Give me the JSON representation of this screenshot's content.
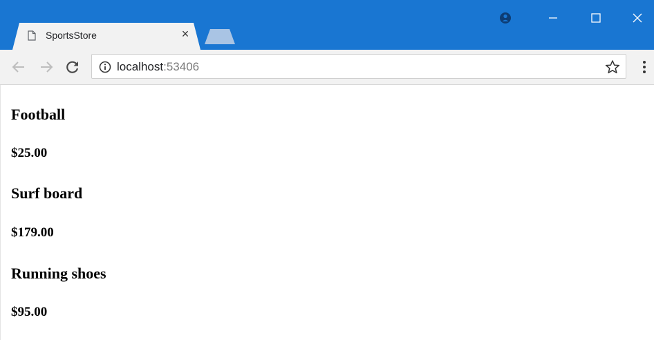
{
  "browser": {
    "tab_title": "SportsStore",
    "address": {
      "host": "localhost",
      "port": ":53406"
    }
  },
  "products": [
    {
      "name": "Football",
      "price": "$25.00"
    },
    {
      "name": "Surf board",
      "price": "$179.00"
    },
    {
      "name": "Running shoes",
      "price": "$95.00"
    }
  ],
  "icons": {
    "page": "page-icon",
    "close": "close-icon",
    "new_tab": "new-tab-icon",
    "account": "account-icon",
    "minimize": "minimize-icon",
    "maximize": "maximize-icon",
    "window_close": "window-close-icon",
    "back": "back-arrow-icon",
    "forward": "forward-arrow-icon",
    "reload": "reload-icon",
    "info": "info-icon",
    "star": "star-icon",
    "menu": "menu-icon"
  },
  "colors": {
    "titlebar": "#1976d2",
    "toolbar": "#f2f2f2"
  }
}
